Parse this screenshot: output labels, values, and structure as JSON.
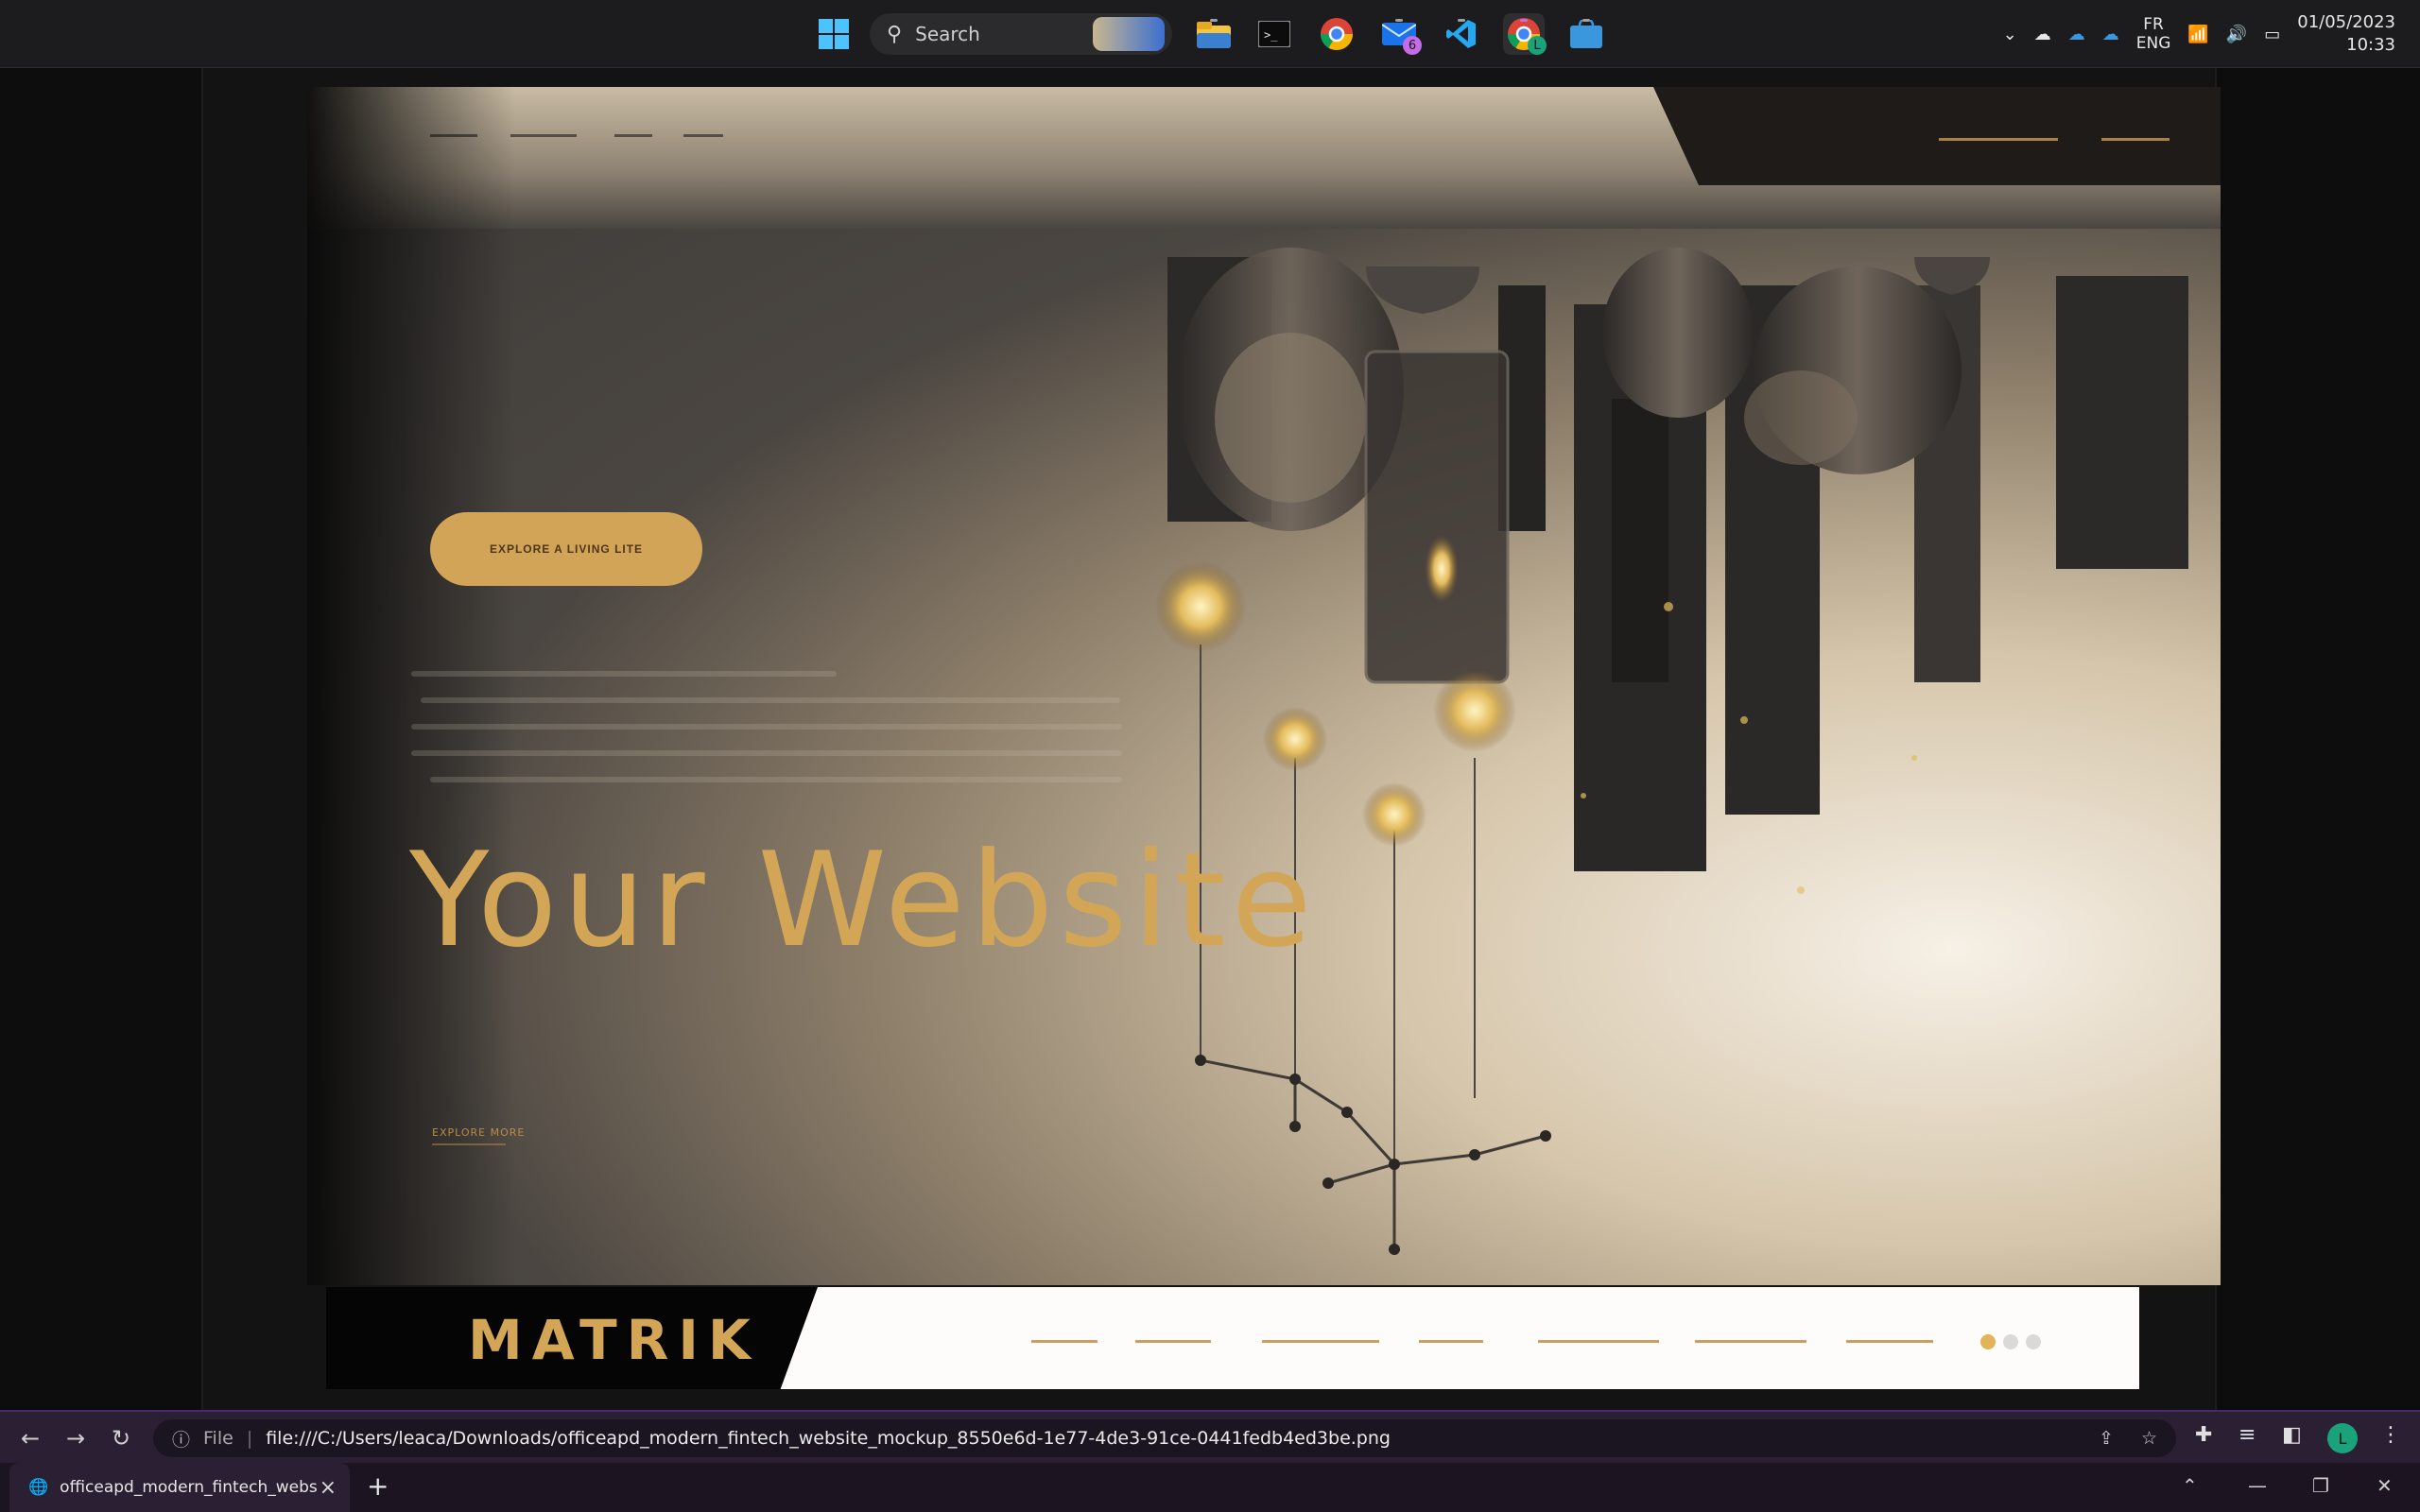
{
  "taskbar": {
    "search_placeholder": "Search",
    "mail_badge": "6",
    "chrome_badge": "L",
    "lang_top": "FR",
    "lang_bottom": "ENG",
    "date": "01/05/2023",
    "time": "10:33"
  },
  "hero": {
    "cta_label": "EXPLORE A LIVING LITE",
    "headline": "Your Website",
    "small_link": "EXPLORE MORE"
  },
  "footer": {
    "logo": "MATRIK"
  },
  "browser": {
    "info_label": "File",
    "url": "file:///C:/Users/leaca/Downloads/officeapd_modern_fintech_website_mockup_8550e6d-1e77-4de3-91ce-0441fedb4ed3be.png",
    "tab_title": "officeapd_modern_fintech_webs",
    "profile_initial": "L"
  }
}
